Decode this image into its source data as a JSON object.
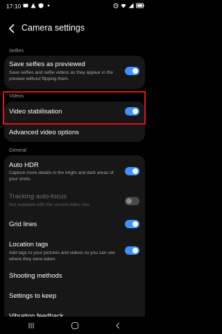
{
  "status_bar": {
    "time": "17:10",
    "left_icons": [
      "message-icon",
      "alert-icon",
      "shield-icon",
      "dot-icon"
    ],
    "right_icons": [
      "alarm-icon",
      "wifi-icon",
      "signal-icon",
      "battery-icon"
    ]
  },
  "header": {
    "title": "Camera settings"
  },
  "sections": {
    "selfies": "Selfies",
    "videos": "Videos",
    "general": "General"
  },
  "settings": {
    "save_selfies": {
      "title": "Save selfies as previewed",
      "subtitle": "Save selfies and selfie videos as they appear in the preview without flipping them.",
      "enabled": true
    },
    "video_stabilisation": {
      "title": "Video stabilisation",
      "enabled": true
    },
    "advanced_video_options": {
      "title": "Advanced video options"
    },
    "auto_hdr": {
      "title": "Auto HDR",
      "subtitle": "Capture more details in the bright and dark areas of your shots.",
      "enabled": true
    },
    "tracking_auto_focus": {
      "title": "Tracking auto-focus",
      "subtitle": "Not available with the current video size.",
      "enabled": false
    },
    "grid_lines": {
      "title": "Grid lines",
      "enabled": true
    },
    "location_tags": {
      "title": "Location tags",
      "subtitle": "Add tags to your pictures and videos so you can see where they were taken.",
      "enabled": true
    },
    "shooting_methods": {
      "title": "Shooting methods"
    },
    "settings_to_keep": {
      "title": "Settings to keep"
    },
    "vibration_feedback": {
      "title": "Vibration feedback"
    }
  },
  "colors": {
    "accent": "#3e91ff",
    "highlight": "#e1121b",
    "card": "#171717",
    "background": "#000000"
  },
  "nav_bar": {
    "buttons": [
      "recents-icon",
      "home-icon",
      "back-icon"
    ]
  }
}
